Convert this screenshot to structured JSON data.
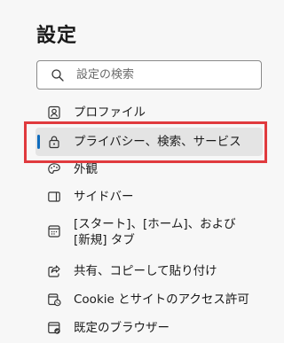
{
  "page": {
    "title": "設定"
  },
  "search": {
    "placeholder": "設定の検索"
  },
  "nav": {
    "items": [
      {
        "label": "プロファイル",
        "icon": "profile-icon"
      },
      {
        "label": "プライバシー、検索、サービス",
        "icon": "lock-icon",
        "selected": true
      },
      {
        "label": "外観",
        "icon": "appearance-icon"
      },
      {
        "label": "サイドバー",
        "icon": "sidebar-icon"
      },
      {
        "label_line1": "[スタート]、[ホーム]、および",
        "label_line2": "[新規] タブ",
        "icon": "start-home-icon"
      },
      {
        "label": "共有、コピーして貼り付け",
        "icon": "share-icon"
      },
      {
        "label": "Cookie とサイトのアクセス許可",
        "icon": "cookie-permissions-icon"
      },
      {
        "label": "既定のブラウザー",
        "icon": "default-browser-icon"
      }
    ]
  },
  "colors": {
    "accent": "#0f6cbd",
    "selected_bg": "#e4e4e4",
    "annotation_border": "#e03a3e",
    "background": "#f7f7f7"
  }
}
